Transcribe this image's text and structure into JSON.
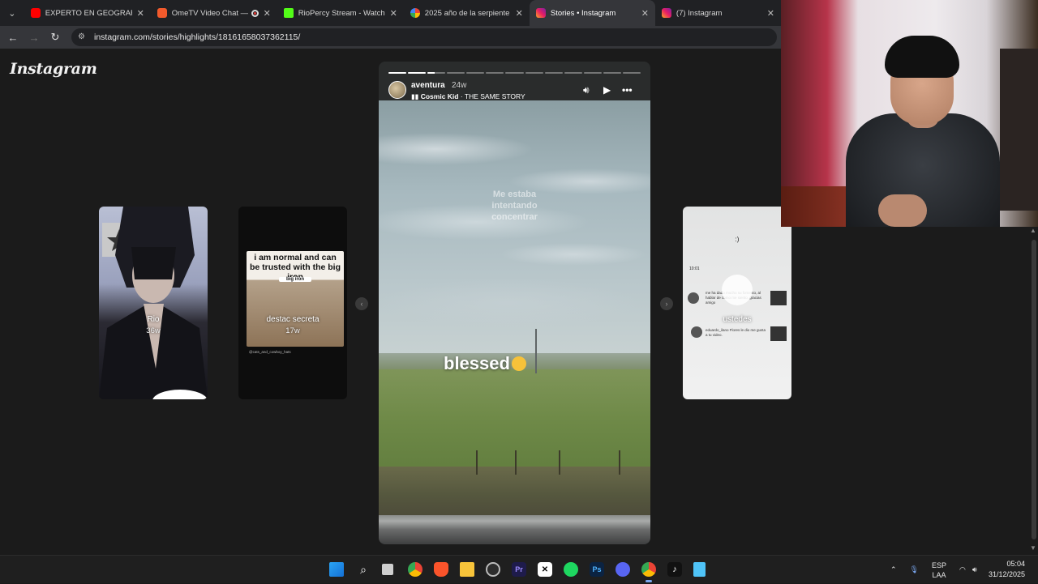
{
  "browser": {
    "tabs": [
      {
        "title": "EXPERTO EN GEOGRAFÍA",
        "favicon": "youtube-icon",
        "active": false
      },
      {
        "title": "OmeTV Video Chat —",
        "favicon": "ometv-icon",
        "active": false
      },
      {
        "title": "RioPercy Stream - Watch L",
        "favicon": "kick-icon",
        "active": false
      },
      {
        "title": "2025 año de la serpiente",
        "favicon": "google-icon",
        "active": false
      },
      {
        "title": "Stories • Instagram",
        "favicon": "instagram-icon",
        "active": true
      },
      {
        "title": "(7) Instagram",
        "favicon": "instagram-icon",
        "active": false
      }
    ],
    "url": "instagram.com/stories/highlights/18161658037362115/"
  },
  "instagram": {
    "logo": "Instagram",
    "left_stories": [
      {
        "label": "Rio",
        "age": "36w"
      },
      {
        "label": "destac secreta",
        "age": "17w",
        "meme_text": "i am normal and can be trusted with the big iron",
        "meme_sub": "big iron",
        "credit": "@cats_and_cowboy_hats"
      }
    ],
    "right_story": {
      "label": "ustedes",
      "top_text": ":)",
      "time": "10:01",
      "comment_1": "me ha dado mucho su fomento, al hablar de como me siento, gracias amigo",
      "comment_2": "eduardo_ilano Flores le dio me gusta a tu video."
    },
    "main_story": {
      "username": "aventura",
      "age": "24w",
      "music_artist": "Cosmic Kid",
      "music_track": "THE SAME STORY",
      "overlay_text": "Me estaba intentando concentrar",
      "caption": "blessed",
      "progress_total": 13,
      "progress_current": 3
    }
  },
  "taskbar": {
    "language": "ESP",
    "layout": "LAA",
    "time": "05:04",
    "date": "31/12/2025"
  },
  "colors": {
    "page_bg": "#1b1b1b",
    "chrome_bg": "#202124",
    "accent": "#7aa7f0"
  }
}
